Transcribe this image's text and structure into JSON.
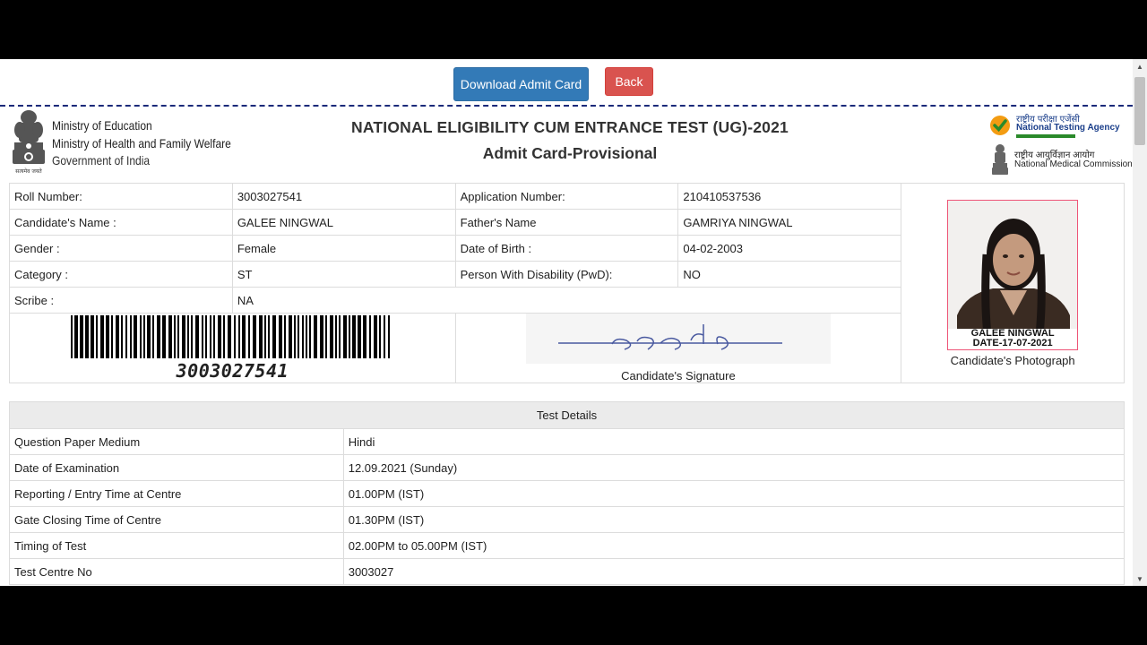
{
  "toolbar": {
    "download_label": "Download Admit Card",
    "back_label": "Back"
  },
  "header": {
    "ministry_lines": [
      "Ministry of Education",
      "Ministry of Health and Family Welfare",
      "Government of India"
    ],
    "emblem_motto": "सत्यमेव जयते",
    "title": "NATIONAL ELIGIBILITY CUM ENTRANCE TEST (UG)-2021",
    "subtitle": "Admit Card-Provisional",
    "nta_hindi": "राष्ट्रीय परीक्षा एजेंसी",
    "nta_name": "National Testing Agency",
    "nmc_hindi": "राष्ट्रीय आयुर्विज्ञान आयोग",
    "nmc_name": "National Medical Commission"
  },
  "candidate": {
    "roll_label": "Roll Number:",
    "roll_value": "3003027541",
    "app_label": "Application Number:",
    "app_value": "210410537536",
    "name_label": "Candidate's Name :",
    "name_value": "GALEE NINGWAL",
    "father_label": "Father's Name",
    "father_value": "GAMRIYA NINGWAL",
    "gender_label": "Gender :",
    "gender_value": "Female",
    "dob_label": "Date of Birth :",
    "dob_value": "04-02-2003",
    "category_label": "Category :",
    "category_value": "ST",
    "pwd_label": "Person With Disability (PwD):",
    "pwd_value": "NO",
    "scribe_label": "Scribe :",
    "scribe_value": "NA",
    "barcode_number": "3003027541",
    "signature_label": "Candidate's Signature",
    "photo_caption_name": "GALEE NINGWAL",
    "photo_caption_date": "DATE-17-07-2021",
    "photo_label": "Candidate's Photograph"
  },
  "test_details": {
    "heading": "Test Details",
    "rows": [
      {
        "label": "Question Paper Medium",
        "value": "Hindi"
      },
      {
        "label": "Date of Examination",
        "value": "12.09.2021 (Sunday)"
      },
      {
        "label": "Reporting / Entry Time at Centre",
        "value": "01.00PM (IST)"
      },
      {
        "label": "Gate Closing Time of Centre",
        "value": "01.30PM (IST)"
      },
      {
        "label": "Timing of Test",
        "value": "02.00PM to 05.00PM (IST)"
      },
      {
        "label": "Test Centre No",
        "value": "3003027"
      }
    ]
  },
  "colors": {
    "download_button": "#337ab7",
    "back_button": "#d9534f",
    "dashed_rule": "#1a2a7a",
    "table_header_bg": "#ebebeb"
  },
  "icons": [
    "national-emblem-icon",
    "nta-check-icon",
    "nmc-emblem-icon",
    "scroll-up-icon",
    "scroll-down-icon"
  ]
}
